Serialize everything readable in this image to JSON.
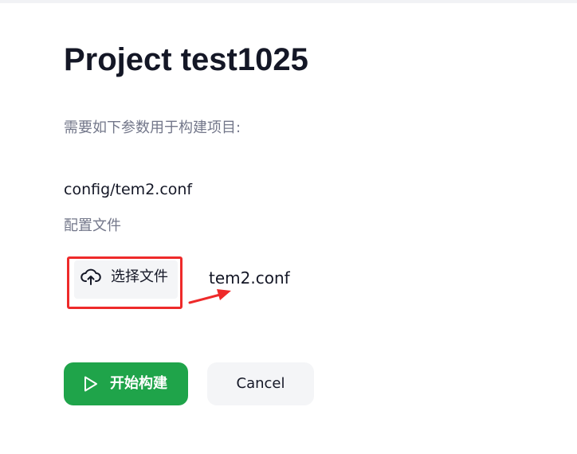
{
  "header": {
    "title": "Project test1025"
  },
  "form": {
    "intro": "需要如下参数用于构建项目:",
    "parameter": {
      "name": "config/tem2.conf",
      "description": "配置文件"
    },
    "upload": {
      "icon": "cloud-upload-icon",
      "label": "选择文件",
      "file_name": "tem2.conf"
    }
  },
  "actions": {
    "build_icon": "play-icon",
    "build_label": "开始构建",
    "cancel_label": "Cancel"
  },
  "annotations": {
    "highlight_color": "#ee2a2a"
  },
  "colors": {
    "primary": "#1fa44a",
    "text": "#141726",
    "muted": "#73778a",
    "button_bg": "#f4f5f7"
  }
}
